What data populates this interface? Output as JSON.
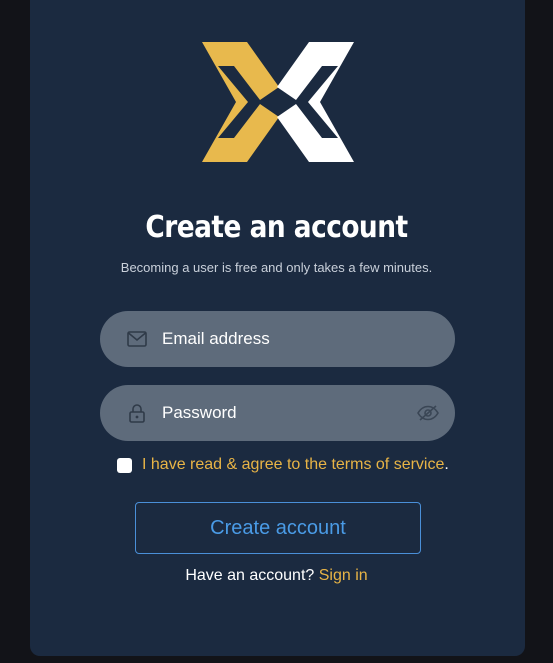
{
  "brand": {
    "logo_icon": "x-logo-icon",
    "colors": {
      "gold": "#E8B94D",
      "white": "#FFFFFF"
    }
  },
  "header": {
    "title": "Create an account",
    "subtitle": "Becoming a user is free and only takes a few minutes."
  },
  "form": {
    "email": {
      "placeholder": "Email address",
      "icon": "envelope-icon"
    },
    "password": {
      "placeholder": "Password",
      "icon": "lock-icon",
      "toggle_icon": "eye-slash-icon"
    },
    "terms": {
      "checked": false,
      "link_text": "I have read & agree to the terms of service",
      "suffix": "."
    },
    "submit_label": "Create account"
  },
  "footer": {
    "prompt": "Have an account?",
    "signin_label": "Sign in"
  },
  "colors": {
    "background": "#121318",
    "card": "#1B2A40",
    "field": "#5E6B7B",
    "accent_gold": "#E8B446",
    "accent_blue": "#4A9BE6"
  }
}
